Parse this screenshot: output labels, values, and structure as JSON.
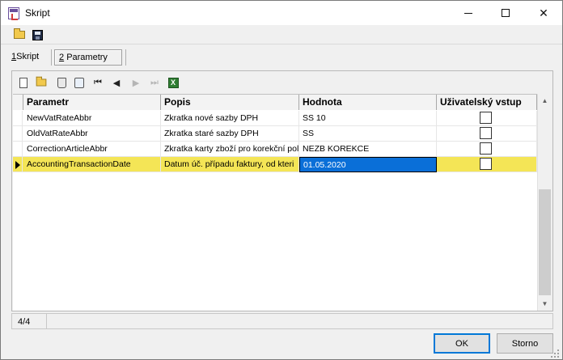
{
  "window": {
    "title": "Skript"
  },
  "toolbar": {
    "icons": [
      "open-folder-icon",
      "save-icon"
    ]
  },
  "tabs": [
    {
      "key": "1",
      "label": "Skript",
      "active": false
    },
    {
      "key": "2",
      "label": "Parametry",
      "active": true
    }
  ],
  "grid_toolbar": {
    "icons": [
      "new-icon",
      "open-icon",
      "delete-icon",
      "refresh-icon",
      "first-icon",
      "prev-icon",
      "next-icon",
      "last-icon",
      "excel-icon"
    ]
  },
  "grid": {
    "columns": [
      "Parametr",
      "Popis",
      "Hodnota",
      "Uživatelský vstup"
    ],
    "rows": [
      {
        "parametr": "NewVatRateAbbr",
        "popis": "Zkratka nové sazby DPH",
        "hodnota": "SS 10",
        "user_input": false
      },
      {
        "parametr": "OldVatRateAbbr",
        "popis": "Zkratka staré sazby DPH",
        "hodnota": "SS",
        "user_input": false
      },
      {
        "parametr": "CorrectionArticleAbbr",
        "popis": "Zkratka karty zboží pro korekční pol",
        "hodnota": "NEZB KOREKCE",
        "user_input": false
      },
      {
        "parametr": "AccountingTransactionDate",
        "popis": "Datum úč. případu faktury, od kteri",
        "hodnota": "01.05.2020",
        "user_input": false,
        "selected": true
      }
    ]
  },
  "status": {
    "position": "4/4"
  },
  "buttons": {
    "ok": "OK",
    "cancel": "Storno"
  },
  "colors": {
    "selected_row": "#f4e556",
    "edit_cell": "#0a6fd8",
    "default_button_border": "#0078d7"
  }
}
